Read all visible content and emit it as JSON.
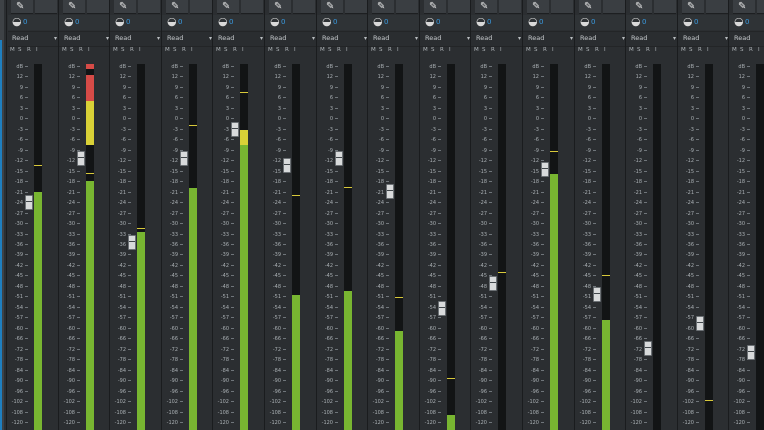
{
  "left_panel": {
    "collapse_caret": "▾",
    "routing_glyph": "⇥",
    "value": "0"
  },
  "icons": {
    "insert": "✎",
    "send": "◒",
    "caret": "▾"
  },
  "msri_labels": [
    "M",
    "S",
    "R",
    "I"
  ],
  "scale_labels": [
    "dB",
    "12",
    "9",
    "6",
    "3",
    "0",
    "-3",
    "-6",
    "-9",
    "-12",
    "-15",
    "-18",
    "-21",
    "-24",
    "-27",
    "-30",
    "-33",
    "-36",
    "-39",
    "-42",
    "-45",
    "-48",
    "-51",
    "-54",
    "-57",
    "-60",
    "-66",
    "-72",
    "-78",
    "-84",
    "-90",
    "-96",
    "-102",
    "-108",
    "-120"
  ],
  "colors": {
    "meter_green": "#78b531",
    "meter_yellow": "#d9d137",
    "meter_red": "#d64b47",
    "peak_line": "#d7c83a",
    "accent_blue": "#3a9ae0"
  },
  "channels": [
    {
      "send_value": "0",
      "automation": "Read",
      "level": 0.65,
      "peak": 0.72,
      "fader": 0.62,
      "clip": false
    },
    {
      "send_value": "0",
      "automation": "Read",
      "level": 0.68,
      "peak": 0.7,
      "fader": 0.74,
      "clip": true
    },
    {
      "send_value": "0",
      "automation": "Read",
      "level": 0.54,
      "peak": 0.55,
      "fader": 0.51,
      "clip": false
    },
    {
      "send_value": "0",
      "automation": "Read",
      "level": 0.66,
      "peak": 0.83,
      "fader": 0.74,
      "clip": false
    },
    {
      "send_value": "0",
      "automation": "Read",
      "level": 0.82,
      "peak": 0.92,
      "fader": 0.82,
      "clip": false
    },
    {
      "send_value": "0",
      "automation": "Read",
      "level": 0.37,
      "peak": 0.64,
      "fader": 0.72,
      "clip": false
    },
    {
      "send_value": "0",
      "automation": "Read",
      "level": 0.38,
      "peak": 0.66,
      "fader": 0.74,
      "clip": false
    },
    {
      "send_value": "0",
      "automation": "Read",
      "level": 0.27,
      "peak": 0.36,
      "fader": 0.65,
      "clip": false
    },
    {
      "send_value": "0",
      "automation": "Read",
      "level": 0.04,
      "peak": 0.14,
      "fader": 0.33,
      "clip": false
    },
    {
      "send_value": "0",
      "automation": "Read",
      "level": 0.0,
      "peak": 0.43,
      "fader": 0.4,
      "clip": false
    },
    {
      "send_value": "0",
      "automation": "Read",
      "level": 0.7,
      "peak": 0.76,
      "fader": 0.71,
      "clip": false
    },
    {
      "send_value": "0",
      "automation": "Read",
      "level": 0.3,
      "peak": 0.42,
      "fader": 0.37,
      "clip": false
    },
    {
      "send_value": "0",
      "automation": "Read",
      "level": 0.0,
      "peak": 0.0,
      "fader": 0.22,
      "clip": false
    },
    {
      "send_value": "0",
      "automation": "Read",
      "level": 0.0,
      "peak": 0.08,
      "fader": 0.29,
      "clip": false
    },
    {
      "send_value": "0",
      "automation": "Read",
      "level": 0.0,
      "peak": 0.0,
      "fader": 0.21,
      "clip": false
    }
  ]
}
